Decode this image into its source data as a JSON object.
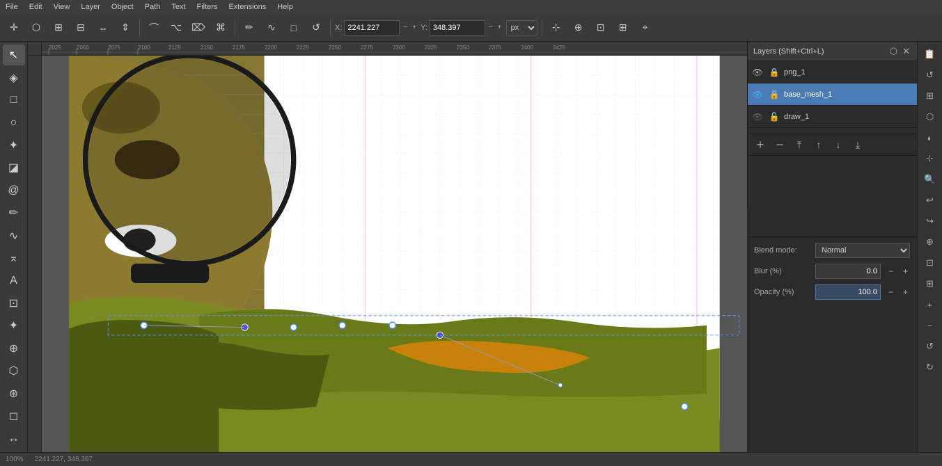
{
  "menubar": {
    "items": [
      "File",
      "Edit",
      "View",
      "Layer",
      "Object",
      "Path",
      "Text",
      "Filters",
      "Extensions",
      "Help"
    ]
  },
  "toolbar": {
    "x_label": "X:",
    "x_value": "2241.227",
    "y_label": "Y:",
    "y_value": "348.397",
    "unit": "px"
  },
  "layers_panel": {
    "title": "Layers (Shift+Ctrl+L)",
    "layers": [
      {
        "name": "png_1",
        "visible": true,
        "locked": true
      },
      {
        "name": "base_mesh_1",
        "visible": true,
        "locked": true,
        "active": true
      },
      {
        "name": "draw_1",
        "visible": false,
        "locked": false
      }
    ],
    "add_label": "+",
    "remove_label": "−",
    "raise_to_top_label": "⤒",
    "raise_label": "↑",
    "lower_label": "↓",
    "lower_to_bottom_label": "⤓"
  },
  "blend": {
    "mode_label": "Blend mode:",
    "mode_value": "Normal",
    "blur_label": "Blur (%)",
    "blur_value": "0.0",
    "opacity_label": "Opacity (%)",
    "opacity_value": "100.0"
  },
  "status": {
    "zoom": "100%",
    "coords": "2241.227, 348.397"
  }
}
